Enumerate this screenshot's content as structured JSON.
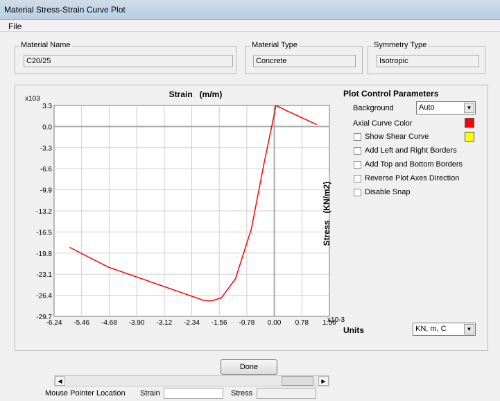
{
  "window": {
    "title": "Material Stress-Strain Curve Plot"
  },
  "menu": {
    "file": "File"
  },
  "material_name": {
    "label": "Material Name",
    "value": "C20/25"
  },
  "material_type": {
    "label": "Material Type",
    "value": "Concrete"
  },
  "symmetry_type": {
    "label": "Symmetry Type",
    "value": "Isotropic"
  },
  "plot_controls": {
    "title": "Plot Control Parameters",
    "background_label": "Background",
    "background_value": "Auto",
    "axial_curve_color_label": "Axial Curve Color",
    "axial_curve_color": "#ff0000",
    "shear_curve_color": "#ffff00",
    "show_shear_curve": "Show Shear Curve",
    "add_left_right_borders": "Add Left and Right Borders",
    "add_top_bottom_borders": "Add Top and Bottom Borders",
    "reverse_axes": "Reverse Plot Axes Direction",
    "disable_snap": "Disable Snap"
  },
  "units": {
    "label": "Units",
    "value": "KN, m, C"
  },
  "mouse": {
    "label": "Mouse Pointer Location",
    "strain_label": "Strain",
    "strain_value": "",
    "stress_label": "Stress",
    "stress_value": ""
  },
  "done_label": "Done",
  "chart_data": {
    "type": "line",
    "xlabel": "Strain   (m/m)",
    "ylabel": "Stress   (KN/m2)",
    "x_multiplier": "x10-3",
    "y_multiplier": "x103",
    "xlim": [
      -6.24,
      1.56
    ],
    "ylim": [
      -29.7,
      3.3
    ],
    "x_ticks": [
      "-6.24",
      "-5.46",
      "-4.68",
      "-3.90",
      "-3.12",
      "-2.34",
      "-1.56",
      "-0.78",
      "0.00",
      "0.78",
      "1.56"
    ],
    "y_ticks": [
      "3.3",
      "0.0",
      "-3.3",
      "-6.6",
      "-9.9",
      "-13.2",
      "-16.5",
      "-19.8",
      "-23.1",
      "-26.4",
      "-29.7"
    ],
    "grid": true,
    "series": [
      {
        "color": "#ff0000",
        "x": [
          -5.8,
          -4.7,
          -2.0,
          -1.8,
          -1.5,
          -1.1,
          -0.65,
          -0.3,
          0.05,
          0.3,
          1.2
        ],
        "y": [
          -18.9,
          -22.0,
          -27.2,
          -27.3,
          -26.8,
          -23.8,
          -16.0,
          -6.0,
          3.3,
          2.6,
          0.3
        ]
      }
    ]
  }
}
